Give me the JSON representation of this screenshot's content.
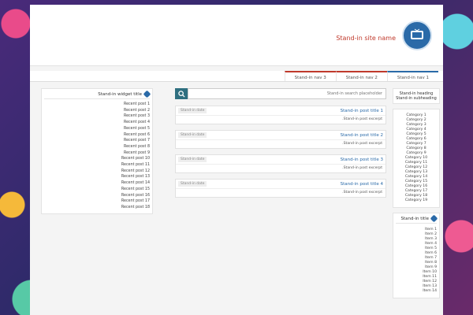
{
  "site": {
    "title": "Stand-in site name"
  },
  "nav": {
    "items": [
      "Stand-in nav 1",
      "Stand-in nav 2",
      "Stand-in nav 3"
    ]
  },
  "search": {
    "placeholder": "Stand-in search placeholder"
  },
  "right_sidebar": {
    "intro": {
      "line1": "Stand-in heading",
      "line2": "Stand-in subheading"
    },
    "categories": [
      "Category 1",
      "Category 2",
      "Category 3",
      "Category 4",
      "Category 5",
      "Category 6",
      "Category 7",
      "Category 8",
      "Category 9",
      "Category 10",
      "Category 11",
      "Category 12",
      "Category 13",
      "Category 14",
      "Category 15",
      "Category 16",
      "Category 17",
      "Category 18",
      "Category 19"
    ],
    "other": {
      "title": "Stand-in title",
      "items": [
        "Item 1",
        "Item 2",
        "Item 3",
        "Item 4",
        "Item 5",
        "Item 6",
        "Item 7",
        "Item 8",
        "Item 9",
        "Item 10",
        "Item 11",
        "Item 12",
        "Item 13",
        "Item 14"
      ]
    }
  },
  "posts": [
    {
      "title": "Stand-in post title 1",
      "date": "Stand-in date",
      "body": "Stand-in post excerpt."
    },
    {
      "title": "Stand-in post title 2",
      "date": "Stand-in date",
      "body": "Stand-in post excerpt."
    },
    {
      "title": "Stand-in post title 3",
      "date": "Stand-in date",
      "body": "Stand-in post excerpt."
    },
    {
      "title": "Stand-in post title 4",
      "date": "Stand-in date",
      "body": "Stand-in post excerpt."
    }
  ],
  "recent": {
    "title": "Stand-in widget title",
    "items": [
      "Recent post 1",
      "Recent post 2",
      "Recent post 3",
      "Recent post 4",
      "Recent post 5",
      "Recent post 6",
      "Recent post 7",
      "Recent post 8",
      "Recent post 9",
      "Recent post 10",
      "Recent post 11",
      "Recent post 12",
      "Recent post 13",
      "Recent post 14",
      "Recent post 15",
      "Recent post 16",
      "Recent post 17",
      "Recent post 18"
    ]
  },
  "colors": {
    "accent": "#2a6aa8",
    "brand_red": "#c0392b"
  }
}
